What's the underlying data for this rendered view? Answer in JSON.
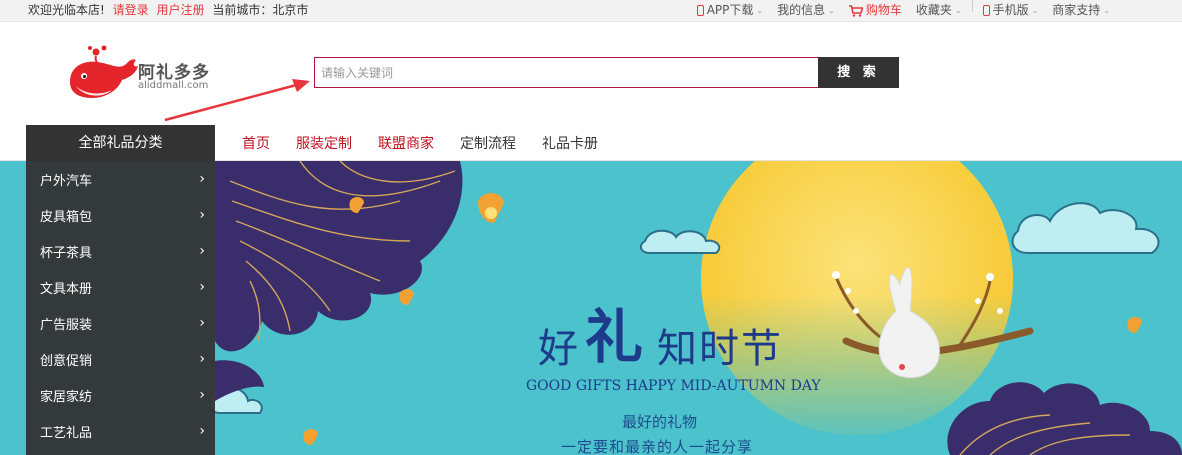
{
  "topbar": {
    "welcome": "欢迎光临本店!",
    "login": "请登录",
    "register": "用户注册",
    "city_label": "当前城市：",
    "city": "北京市",
    "app_download": "APP下载",
    "my_info": "我的信息",
    "cart": "购物车",
    "favorites": "收藏夹",
    "mobile": "手机版",
    "merchant_support": "商家支持"
  },
  "logo": {
    "name": "阿礼多多",
    "domain": "aliddmall.com"
  },
  "search": {
    "placeholder": "请输入关键词",
    "button": "搜 索"
  },
  "nav": {
    "category_header": "全部礼品分类",
    "links": [
      "首页",
      "服装定制",
      "联盟商家",
      "定制流程",
      "礼品卡册"
    ]
  },
  "sidebar": {
    "items": [
      {
        "label": "户外汽车"
      },
      {
        "label": "皮具箱包"
      },
      {
        "label": "杯子茶具"
      },
      {
        "label": "文具本册"
      },
      {
        "label": "广告服装"
      },
      {
        "label": "创意促销"
      },
      {
        "label": "家居家纺"
      },
      {
        "label": "工艺礼品"
      }
    ]
  },
  "banner": {
    "title_hao": "好",
    "title_li": "礼",
    "title_rest": "知时节",
    "title_en": "GOOD GIFTS  HAPPY MID-AUTUMN DAY",
    "line1": "最好的礼物",
    "line2": "一定要和最亲的人一起分享"
  },
  "colors": {
    "accent_red": "#e4393c",
    "nav_red": "#c1121f",
    "dark": "#333333",
    "banner_bg": "#4cc3cc",
    "moon": "#f9d84a",
    "title_blue": "#1e3a8a"
  }
}
